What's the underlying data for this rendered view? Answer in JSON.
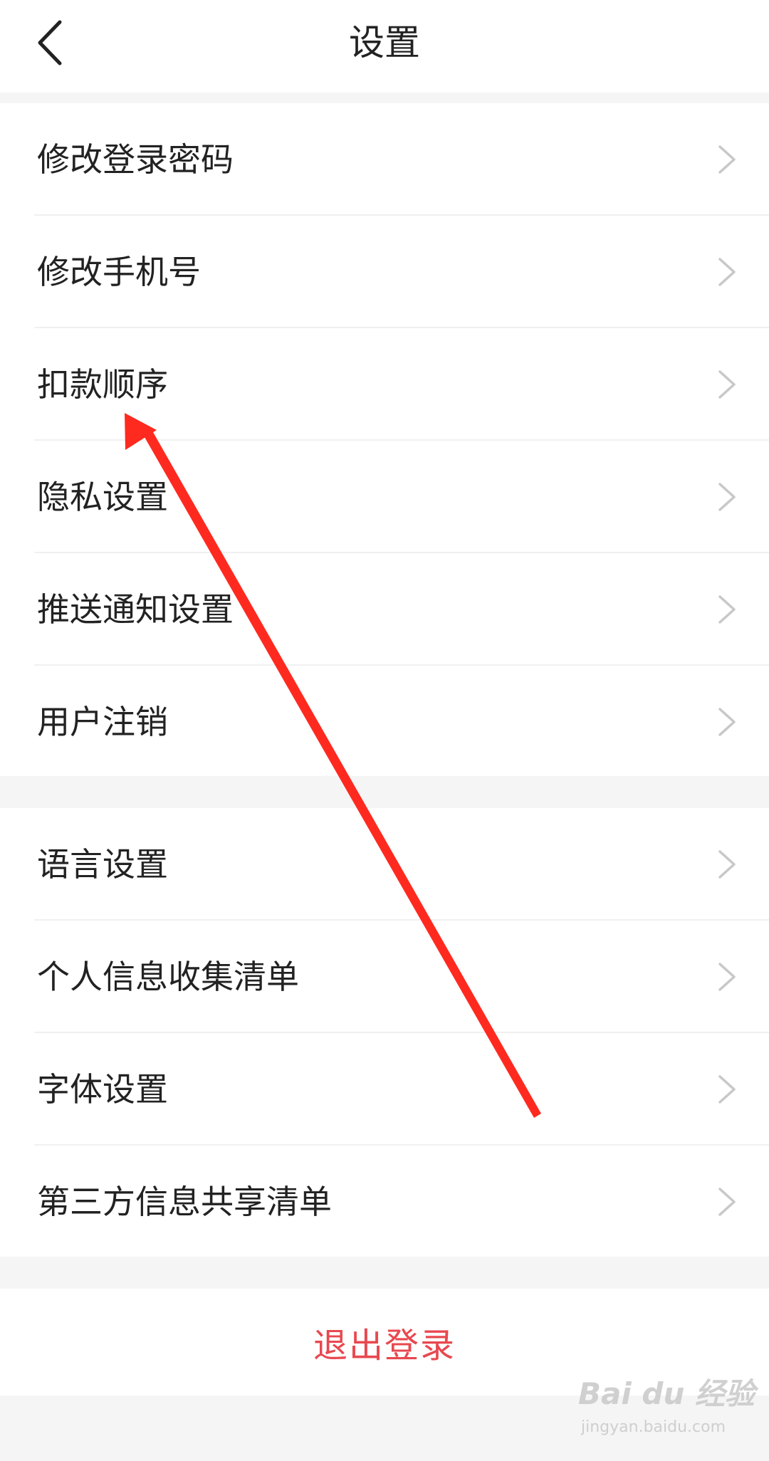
{
  "header": {
    "title": "设置",
    "back_icon": "chevron-left-icon"
  },
  "settings": {
    "group_1": [
      {
        "label": "修改登录密码"
      },
      {
        "label": "修改手机号"
      },
      {
        "label": "扣款顺序"
      },
      {
        "label": "隐私设置"
      },
      {
        "label": "推送通知设置"
      },
      {
        "label": "用户注销"
      }
    ],
    "group_2": [
      {
        "label": "语言设置"
      },
      {
        "label": "个人信息收集清单"
      },
      {
        "label": "字体设置"
      },
      {
        "label": "第三方信息共享清单"
      }
    ],
    "chevron_icon": "chevron-right-icon"
  },
  "logout": {
    "label": "退出登录",
    "color": "#e8484f"
  },
  "watermark": {
    "brand": "Bai du 经验",
    "url": "jingyan.baidu.com"
  },
  "annotation": {
    "color": "#ff2a1f",
    "target": "扣款顺序"
  }
}
